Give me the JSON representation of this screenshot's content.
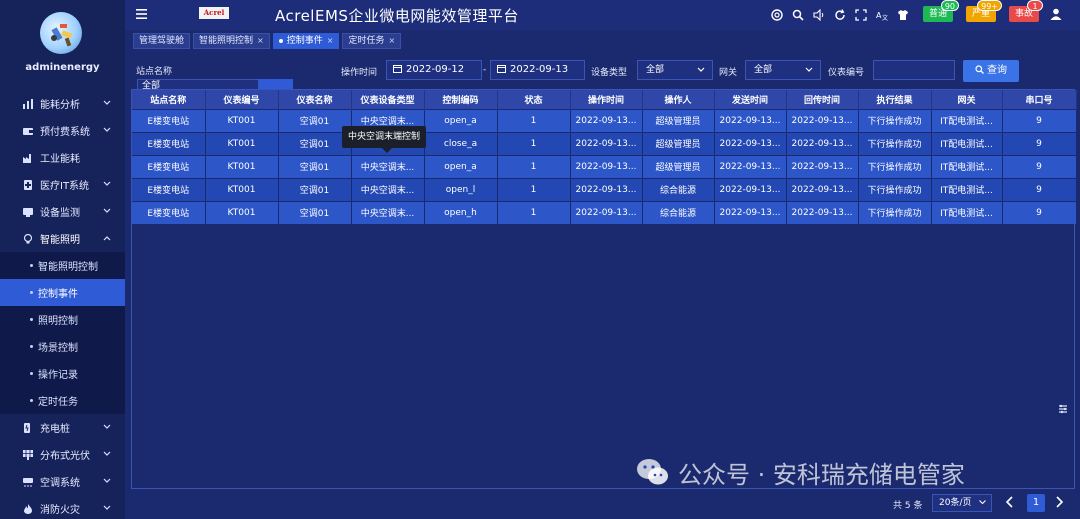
{
  "user": {
    "name": "adminenergy"
  },
  "sidebar": {
    "items": [
      {
        "label": "能耗分析",
        "icon": "bar-chart-icon",
        "has_chevron": true
      },
      {
        "label": "预付费系统",
        "icon": "wallet-icon",
        "has_chevron": true
      },
      {
        "label": "工业能耗",
        "icon": "factory-icon",
        "has_chevron": false
      },
      {
        "label": "医疗IT系统",
        "icon": "medical-icon",
        "has_chevron": true
      },
      {
        "label": "设备监测",
        "icon": "monitor-icon",
        "has_chevron": true
      },
      {
        "label": "智能照明",
        "icon": "bulb-icon",
        "has_chevron": true,
        "open": true
      }
    ],
    "submenu": [
      {
        "label": "智能照明控制"
      },
      {
        "label": "控制事件",
        "active": true
      },
      {
        "label": "照明控制"
      },
      {
        "label": "场景控制"
      },
      {
        "label": "操作记录"
      },
      {
        "label": "定时任务"
      }
    ],
    "items_after": [
      {
        "label": "充电桩",
        "icon": "charger-icon",
        "has_chevron": true
      },
      {
        "label": "分布式光伏",
        "icon": "solar-icon",
        "has_chevron": true
      },
      {
        "label": "空调系统",
        "icon": "aircon-icon",
        "has_chevron": true
      },
      {
        "label": "消防火灾",
        "icon": "fire-icon",
        "has_chevron": true
      }
    ]
  },
  "topbar": {
    "logo_text": "Acrel",
    "title": "AcrelEMS企业微电网能效管理平台",
    "alarms": [
      {
        "label": "普通",
        "count": "90",
        "color": "#1db954"
      },
      {
        "label": "严重",
        "count": "99+",
        "color": "#f0a500"
      },
      {
        "label": "事故",
        "count": "1",
        "color": "#e84a4a"
      }
    ]
  },
  "tabs": [
    {
      "label": "管理驾驶舱",
      "closable": false
    },
    {
      "label": "智能照明控制",
      "closable": true
    },
    {
      "label": "控制事件",
      "closable": true,
      "active": true
    },
    {
      "label": "定时任务",
      "closable": true
    }
  ],
  "filters": {
    "station_label": "站点名称",
    "station_value": "全部",
    "time_label": "操作时间",
    "date_from": "2022-09-12",
    "date_sep": "-",
    "date_to": "2022-09-13",
    "device_type_label": "设备类型",
    "device_type_value": "全部",
    "gateway_label": "网关",
    "gateway_value": "全部",
    "meter_label": "仪表编号",
    "meter_value": "",
    "query_label": "查询"
  },
  "table": {
    "columns": [
      "站点名称",
      "仪表编号",
      "仪表名称",
      "仪表设备类型",
      "控制编码",
      "状态",
      "操作时间",
      "操作人",
      "发送时间",
      "回传时间",
      "执行结果",
      "网关",
      "串口号"
    ],
    "rows": [
      [
        "E楼变电站",
        "KT001",
        "空调01",
        "中央空调末...",
        "open_a",
        "1",
        "2022-09-13...",
        "超级管理员",
        "2022-09-13...",
        "2022-09-13...",
        "下行操作成功",
        "IT配电测试...",
        "9"
      ],
      [
        "E楼变电站",
        "KT001",
        "空调01",
        "中央空调末...",
        "close_a",
        "1",
        "2022-09-13...",
        "超级管理员",
        "2022-09-13...",
        "2022-09-13...",
        "下行操作成功",
        "IT配电测试...",
        "9"
      ],
      [
        "E楼变电站",
        "KT001",
        "空调01",
        "中央空调末...",
        "open_a",
        "1",
        "2022-09-13...",
        "超级管理员",
        "2022-09-13...",
        "2022-09-13...",
        "下行操作成功",
        "IT配电测试...",
        "9"
      ],
      [
        "E楼变电站",
        "KT001",
        "空调01",
        "中央空调末...",
        "open_l",
        "1",
        "2022-09-13...",
        "综合能源",
        "2022-09-13...",
        "2022-09-13...",
        "下行操作成功",
        "IT配电测试...",
        "9"
      ],
      [
        "E楼变电站",
        "KT001",
        "空调01",
        "中央空调末...",
        "open_h",
        "1",
        "2022-09-13...",
        "综合能源",
        "2022-09-13...",
        "2022-09-13...",
        "下行操作成功",
        "IT配电测试...",
        "9"
      ]
    ],
    "tooltip": "中央空调末端控制"
  },
  "watermark": "公众号 · 安科瑞充储电管家",
  "pagination": {
    "total": "共 5 条",
    "page_size": "20条/页",
    "current_page": "1"
  }
}
